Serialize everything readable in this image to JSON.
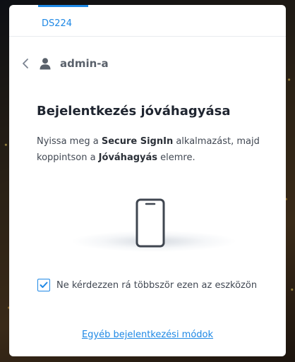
{
  "tab": {
    "label": "DS224"
  },
  "account": {
    "name": "admin-a",
    "back_icon": "chevron-left-icon",
    "user_icon": "user-icon"
  },
  "content": {
    "title": "Bejelentkezés jóváhagyása",
    "desc_part1": "Nyissa meg a ",
    "desc_app": "Secure SignIn",
    "desc_part2": " alkalmazást, majd koppintson a ",
    "desc_action": "Jóváhagyás",
    "desc_part3": " elemre.",
    "illustration_icon": "smartphone-icon"
  },
  "remember": {
    "label": "Ne kérdezzen rá többször ezen az eszközön",
    "checked": true
  },
  "other_methods_link": "Egyéb bejelentkezési módok",
  "colors": {
    "accent": "#1e88e5",
    "title": "#1f2530",
    "text": "#414853"
  }
}
